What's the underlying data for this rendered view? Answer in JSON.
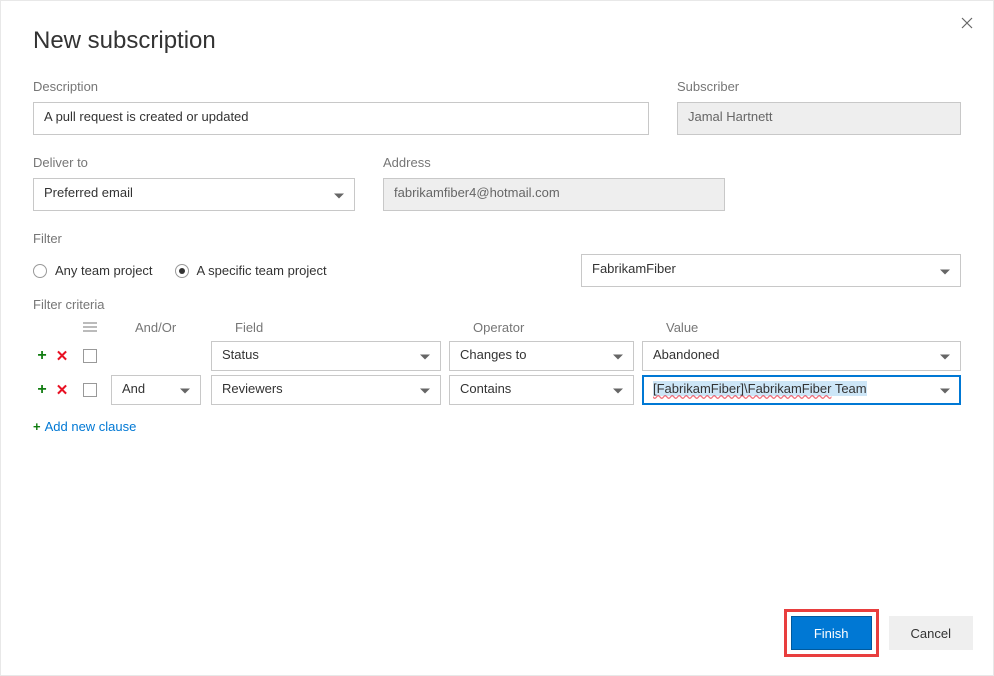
{
  "title": "New subscription",
  "description": {
    "label": "Description",
    "value": "A pull request is created or updated"
  },
  "subscriber": {
    "label": "Subscriber",
    "value": "Jamal Hartnett"
  },
  "deliver": {
    "label": "Deliver to",
    "value": "Preferred email"
  },
  "address": {
    "label": "Address",
    "value": "fabrikamfiber4@hotmail.com"
  },
  "filter": {
    "label": "Filter",
    "any_text": "Any team project",
    "specific_text": "A specific team project",
    "project": "FabrikamFiber"
  },
  "criteria": {
    "label": "Filter criteria",
    "headers": {
      "andor": "And/Or",
      "field": "Field",
      "operator": "Operator",
      "value": "Value"
    },
    "rows": [
      {
        "andor": "",
        "field": "Status",
        "operator": "Changes to",
        "value": "Abandoned"
      },
      {
        "andor": "And",
        "field": "Reviewers",
        "operator": "Contains",
        "value_prefix": "[FabrikamFiber]\\FabrikamFiber",
        "value_suffix": " Team"
      }
    ],
    "add_clause": "Add new clause"
  },
  "buttons": {
    "finish": "Finish",
    "cancel": "Cancel"
  }
}
